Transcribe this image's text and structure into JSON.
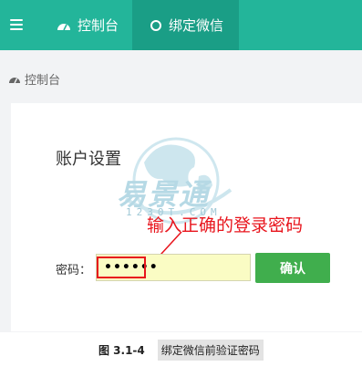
{
  "topbar": {
    "nav": [
      {
        "label": "控制台",
        "icon": "dashboard-gauge-icon"
      },
      {
        "label": "绑定微信",
        "icon": "ring-icon"
      }
    ],
    "menu_icon": "hamburger-menu-icon"
  },
  "breadcrumb": {
    "label": "控制台",
    "icon": "dashboard-gauge-icon"
  },
  "section": {
    "title": "账户设置"
  },
  "watermark": {
    "brand": "易景通",
    "domain": "1230T.COM"
  },
  "annotation": {
    "text": "输入正确的登录密码"
  },
  "form": {
    "password_label": "密码：",
    "password_value": "••••••",
    "confirm_label": "确认"
  },
  "caption": {
    "figure": "图 3.1-4",
    "text": "绑定微信前验证密码"
  },
  "colors": {
    "topbar": "#23b59a",
    "active_tab": "#1a9e86",
    "button": "#40ae4d",
    "annotation": "#e8141c"
  }
}
